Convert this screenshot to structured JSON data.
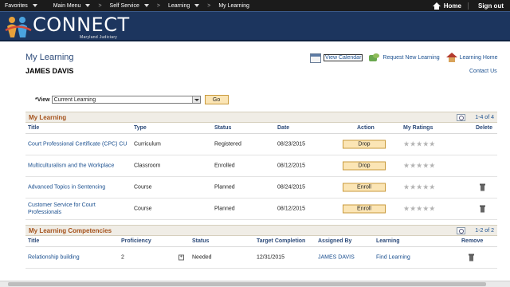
{
  "topnav": {
    "favorites": "Favorites",
    "main_menu": "Main Menu",
    "sep": ">",
    "crumbs": [
      "Self Service",
      "Learning",
      "My Learning"
    ],
    "home": "Home",
    "sign_out": "Sign out"
  },
  "brand": {
    "name": "CONNECT",
    "sub": "Maryland Judiciary"
  },
  "page": {
    "title": "My Learning",
    "user": "JAMES DAVIS",
    "actions": {
      "calendar": "View Calendar",
      "request": "Request New Learning",
      "home": "Learning Home"
    },
    "contact": "Contact Us"
  },
  "view": {
    "label": "*View",
    "selected": "Current Learning",
    "go": "Go"
  },
  "learning": {
    "title": "My Learning",
    "nav": "1-4 of 4",
    "headers": [
      "Title",
      "Type",
      "Status",
      "Date",
      "Action",
      "My Ratings",
      "Delete"
    ],
    "rows": [
      {
        "title": "Court Professional Certificate (CPC) CU",
        "type": "Curriculum",
        "status": "Registered",
        "date": "08/23/2015",
        "action": "Drop",
        "stars": "★★★★★"
      },
      {
        "title": "Multiculturalism and the Workplace",
        "type": "Classroom",
        "status": "Enrolled",
        "date": "08/12/2015",
        "action": "Drop",
        "stars": "★★★★★"
      },
      {
        "title": "Advanced Topics in Sentencing",
        "type": "Course",
        "status": "Planned",
        "date": "08/24/2015",
        "action": "Enroll",
        "stars": "★★★★★"
      },
      {
        "title": "Customer Service for Court Professionals",
        "type": "Course",
        "status": "Planned",
        "date": "08/12/2015",
        "action": "Enroll",
        "stars": "★★★★★"
      }
    ]
  },
  "competencies": {
    "title": "My Learning Competencies",
    "nav": "1-2 of 2",
    "headers": [
      "Title",
      "Proficiency",
      "Status",
      "Target Completion",
      "Assigned By",
      "Learning",
      "Remove"
    ],
    "rows": [
      {
        "title": "Relationship building",
        "proficiency": "2",
        "status": "Needed",
        "target": "12/31/2015",
        "assigned": "JAMES DAVIS",
        "learning": "Find Learning",
        "plus": "+"
      }
    ]
  }
}
